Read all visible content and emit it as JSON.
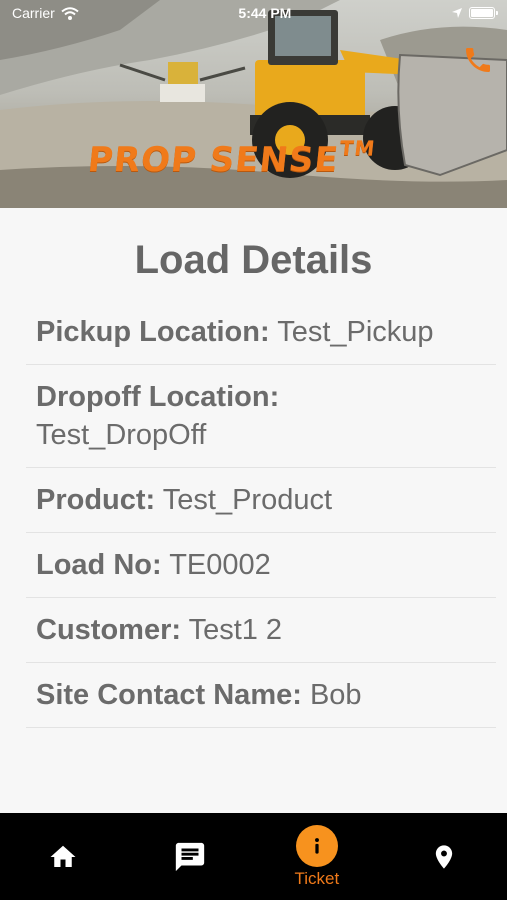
{
  "status_bar": {
    "carrier": "Carrier",
    "time": "5:44 PM"
  },
  "brand": {
    "name": "PROP SENSE",
    "trademark": "TM"
  },
  "page": {
    "title": "Load Details"
  },
  "details": [
    {
      "label": "Pickup Location:",
      "value": "Test_Pickup"
    },
    {
      "label": "Dropoff Location:",
      "value": "Test_DropOff"
    },
    {
      "label": "Product:",
      "value": "Test_Product"
    },
    {
      "label": "Load No:",
      "value": "TE0002"
    },
    {
      "label": "Customer:",
      "value": "Test1 2"
    },
    {
      "label": "Site Contact Name:",
      "value": "Bob"
    }
  ],
  "tabs": [
    {
      "icon": "home-icon",
      "label": ""
    },
    {
      "icon": "chat-icon",
      "label": ""
    },
    {
      "icon": "info-icon",
      "label": "Ticket",
      "active": true
    },
    {
      "icon": "location-pin-icon",
      "label": ""
    }
  ],
  "colors": {
    "accent": "#f07a1a",
    "tab_active_bg": "#f7921e",
    "tabbar": "#000000",
    "text": "#666666"
  }
}
